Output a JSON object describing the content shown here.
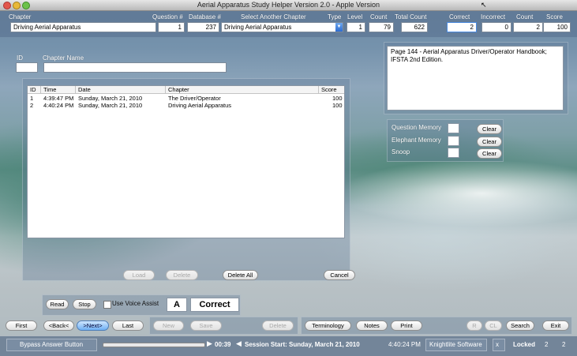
{
  "window": {
    "title": "Aerial Apparatus Study Helper Version 2.0 - Apple Version"
  },
  "colors": {
    "accent": "#2c6bd0",
    "selection": "#6fb0f4"
  },
  "header": {
    "chapter_label": "Chapter",
    "chapter_value": "Driving Aerial Apparatus",
    "question_label": "Question #",
    "question_value": "1",
    "database_label": "Database #",
    "database_value": "237",
    "select_chapter_label": "Select Another Chapter",
    "select_chapter_value": "Driving Aerial Apparatus",
    "type_label": "Type",
    "level_label": "Level",
    "level_value": "1",
    "count_label": "Count",
    "count_value": "79",
    "total_count_label": "Total Count",
    "total_count_value": "622",
    "correct_label": "Correct",
    "correct_value": "2",
    "incorrect_label": "Incorrect",
    "incorrect_value": "0",
    "count2_label": "Count",
    "count2_value": "2",
    "score_label": "Score",
    "score_value": "100"
  },
  "edit": {
    "id_label": "ID",
    "chapter_name_label": "Chapter Name",
    "id_value": "",
    "chapter_name_value": ""
  },
  "reference": {
    "text": "Page 144 - Aerial Apparatus Driver/Operator Handbook; IFSTA 2nd Edition."
  },
  "table": {
    "columns": [
      "ID",
      "Time",
      "Date",
      "Chapter",
      "Score"
    ],
    "rows": [
      [
        "1",
        "4:39:47 PM",
        "Sunday, March 21, 2010",
        "The Driver/Operator",
        "100"
      ],
      [
        "2",
        "4:40:24 PM",
        "Sunday, March 21, 2010",
        "Driving Aerial Apparatus",
        "100"
      ]
    ]
  },
  "memory": {
    "question_memory": "Question Memory",
    "elephant_memory": "Elephant Memory",
    "snoop": "Snoop",
    "clear": "Clear"
  },
  "table_buttons": {
    "load": "Load",
    "delete": "Delete",
    "delete_all": "Delete All",
    "cancel": "Cancel"
  },
  "voice": {
    "read": "Read",
    "stop": "Stop",
    "use_voice_assist": "Use Voice Assist",
    "answer": "A",
    "result": "Correct"
  },
  "nav": {
    "first": "First",
    "back": "<Back<",
    "next": ">Next>",
    "last": "Last",
    "new": "New",
    "save": "Save",
    "delete": "Delete",
    "terminology": "Terminology",
    "notes": "Notes",
    "print": "Print",
    "r": "R",
    "cl": "CL",
    "search": "Search",
    "exit": "Exit"
  },
  "statusbar": {
    "bypass": "Bypass Answer Button",
    "timer": "00:39",
    "progress": 0.0,
    "session": "Session Start:  Sunday, March 21, 2010",
    "time": "4:40:24 PM",
    "vendor": "Knightlite Software",
    "x": "x",
    "locked": "Locked",
    "n1": "2",
    "n2": "2"
  }
}
